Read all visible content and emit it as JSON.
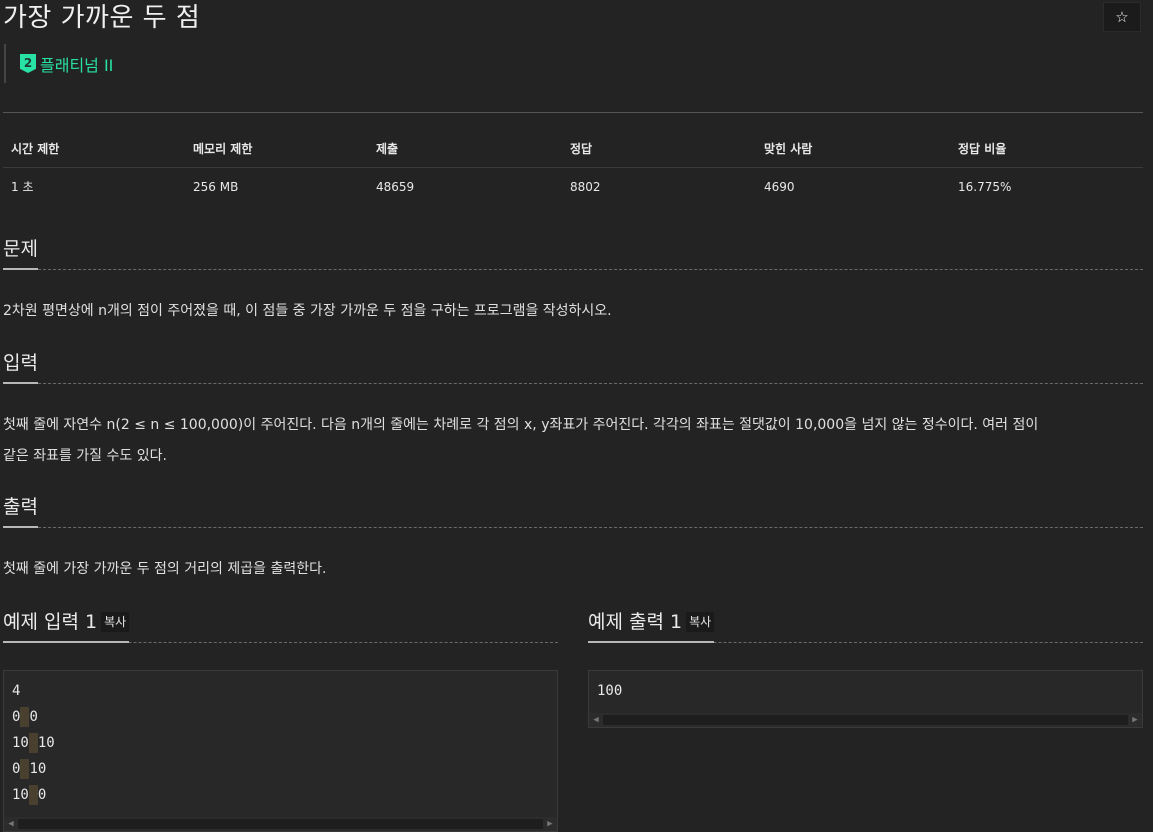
{
  "problem": {
    "title": "가장 가까운 두 점",
    "star_icon": "☆",
    "tier": {
      "badge": "2",
      "label": "플래티넘 II",
      "color": "#27e2a4"
    }
  },
  "stats": {
    "headers": [
      "시간 제한",
      "메모리 제한",
      "제출",
      "정답",
      "맞힌 사람",
      "정답 비율"
    ],
    "values": [
      "1 초",
      "256 MB",
      "48659",
      "8802",
      "4690",
      "16.775%"
    ]
  },
  "sections": {
    "problem": {
      "heading": "문제",
      "text": "2차원 평면상에 n개의 점이 주어졌을 때, 이 점들 중 가장 가까운 두 점을 구하는 프로그램을 작성하시오."
    },
    "input": {
      "heading": "입력",
      "text_line1": "첫째 줄에 자연수 n(2 ≤ n ≤ 100,000)이 주어진다. 다음 n개의 줄에는 차례로 각 점의 x, y좌표가 주어진다. 각각의 좌표는 절댓값이 10,000을 넘지 않는 정수이다. 여러 점이",
      "text_line2": "같은 좌표를 가질 수도 있다."
    },
    "output": {
      "heading": "출력",
      "text": "첫째 줄에 가장 가까운 두 점의 거리의 제곱을 출력한다."
    }
  },
  "samples": {
    "input": {
      "heading": "예제 입력 1",
      "copy_label": "복사",
      "lines": [
        {
          "a": "4",
          "b": ""
        },
        {
          "a": "0",
          "b": "0"
        },
        {
          "a": "10",
          "b": "10"
        },
        {
          "a": "0",
          "b": "10"
        },
        {
          "a": "10",
          "b": "0"
        }
      ]
    },
    "output": {
      "heading": "예제 출력 1",
      "copy_label": "복사",
      "lines": [
        "100"
      ]
    }
  }
}
